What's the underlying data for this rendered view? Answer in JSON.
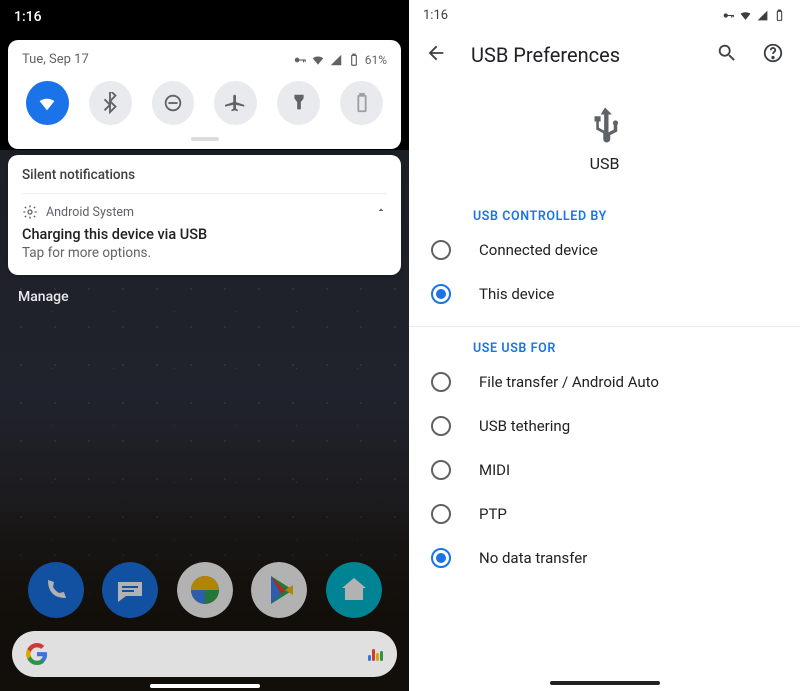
{
  "left": {
    "status_time": "1:16",
    "qs": {
      "date": "Tue, Sep 17",
      "battery_pct": "61%",
      "tiles": [
        {
          "name": "wifi",
          "active": true
        },
        {
          "name": "bluetooth",
          "active": false
        },
        {
          "name": "dnd",
          "active": false
        },
        {
          "name": "airplane",
          "active": false
        },
        {
          "name": "flashlight",
          "active": false
        },
        {
          "name": "battery-saver",
          "active": false
        }
      ]
    },
    "notif": {
      "section_title": "Silent notifications",
      "app_name": "Android System",
      "title": "Charging this device via USB",
      "subtitle": "Tap for more options."
    },
    "manage_label": "Manage"
  },
  "right": {
    "status_time": "1:16",
    "appbar_title": "USB Preferences",
    "hero_label": "USB",
    "section1": {
      "header": "USB CONTROLLED BY",
      "items": [
        {
          "label": "Connected device",
          "checked": false
        },
        {
          "label": "This device",
          "checked": true
        }
      ]
    },
    "section2": {
      "header": "USE USB FOR",
      "items": [
        {
          "label": "File transfer / Android Auto",
          "checked": false
        },
        {
          "label": "USB tethering",
          "checked": false
        },
        {
          "label": "MIDI",
          "checked": false
        },
        {
          "label": "PTP",
          "checked": false
        },
        {
          "label": "No data transfer",
          "checked": true
        }
      ]
    }
  }
}
